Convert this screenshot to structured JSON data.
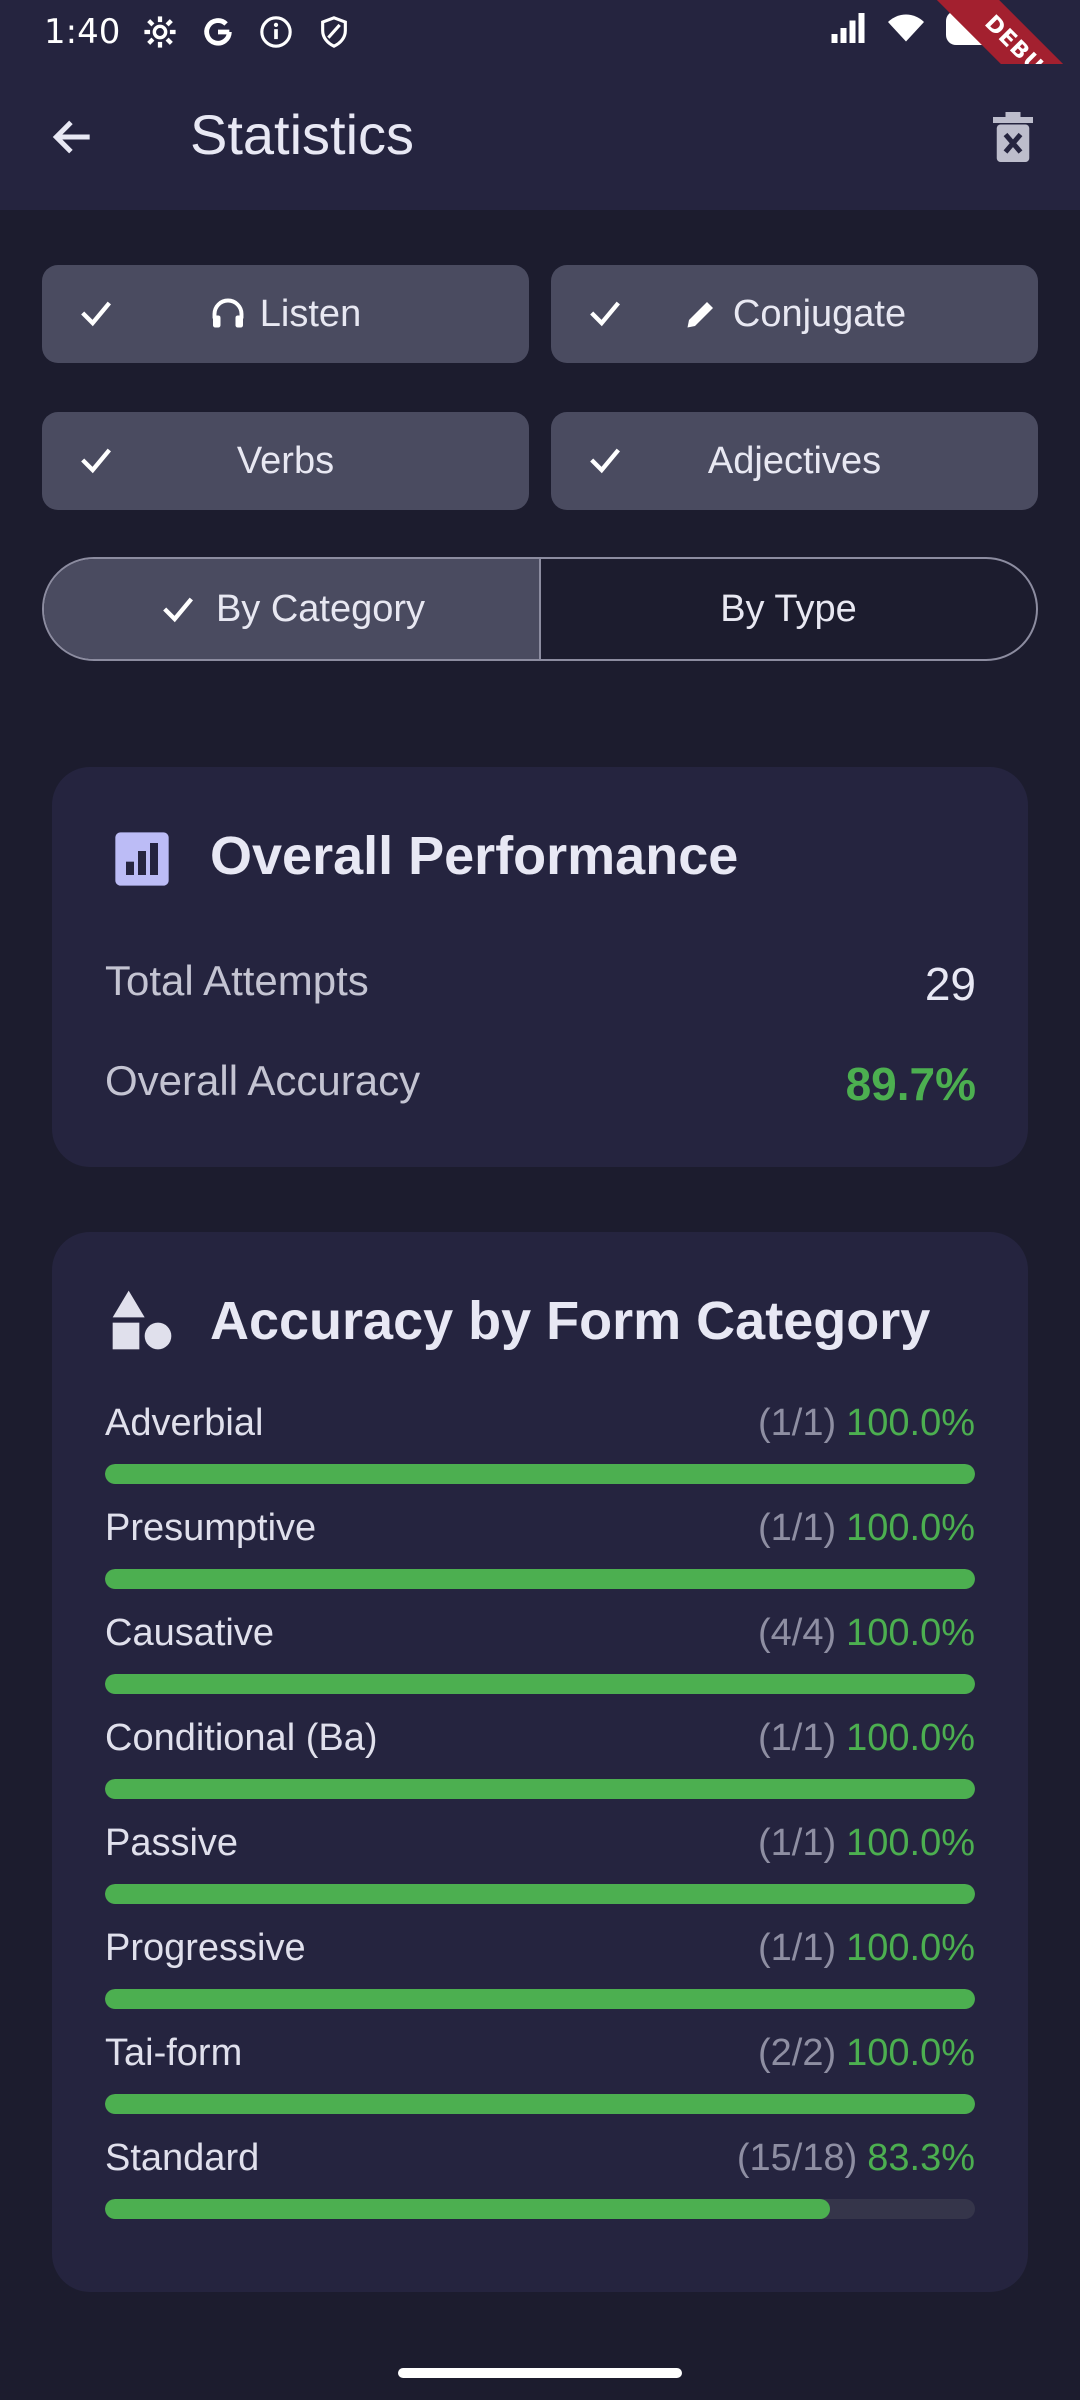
{
  "status_bar": {
    "time": "1:40",
    "icons_left": [
      "settings-icon",
      "google-icon",
      "info-icon",
      "shield-icon"
    ],
    "icons_right": [
      "signal-icon",
      "wifi-icon",
      "battery-icon"
    ]
  },
  "debug_banner": "DEBUG",
  "app_bar": {
    "title": "Statistics",
    "back_icon": "arrow-left-icon",
    "action_icon": "delete-icon"
  },
  "filters": {
    "modes": [
      {
        "label": "Listen",
        "icon": "headphones-icon",
        "selected": true
      },
      {
        "label": "Conjugate",
        "icon": "pencil-icon",
        "selected": true
      }
    ],
    "word_types": [
      {
        "label": "Verbs",
        "selected": true
      },
      {
        "label": "Adjectives",
        "selected": true
      }
    ],
    "grouping": [
      {
        "label": "By Category",
        "selected": true
      },
      {
        "label": "By Type",
        "selected": false
      }
    ]
  },
  "overall": {
    "title": "Overall Performance",
    "icon": "bar-chart-icon",
    "total_attempts_label": "Total Attempts",
    "total_attempts_value": "29",
    "accuracy_label": "Overall Accuracy",
    "accuracy_value": "89.7%"
  },
  "by_category": {
    "title": "Accuracy by Form Category",
    "icon": "shapes-icon",
    "items": [
      {
        "name": "Adverbial",
        "count": "(1/1)",
        "percent": "100.0%",
        "fraction": 1.0
      },
      {
        "name": "Presumptive",
        "count": "(1/1)",
        "percent": "100.0%",
        "fraction": 1.0
      },
      {
        "name": "Causative",
        "count": "(4/4)",
        "percent": "100.0%",
        "fraction": 1.0
      },
      {
        "name": "Conditional (Ba)",
        "count": "(1/1)",
        "percent": "100.0%",
        "fraction": 1.0
      },
      {
        "name": "Passive",
        "count": "(1/1)",
        "percent": "100.0%",
        "fraction": 1.0
      },
      {
        "name": "Progressive",
        "count": "(1/1)",
        "percent": "100.0%",
        "fraction": 1.0
      },
      {
        "name": "Tai-form",
        "count": "(2/2)",
        "percent": "100.0%",
        "fraction": 1.0
      },
      {
        "name": "Standard",
        "count": "(15/18)",
        "percent": "83.3%",
        "fraction": 0.833
      }
    ]
  },
  "colors": {
    "accent_green": "#4caf50",
    "surface": "#25243f",
    "background": "#1c1c2e",
    "chip": "#4a4b60"
  }
}
